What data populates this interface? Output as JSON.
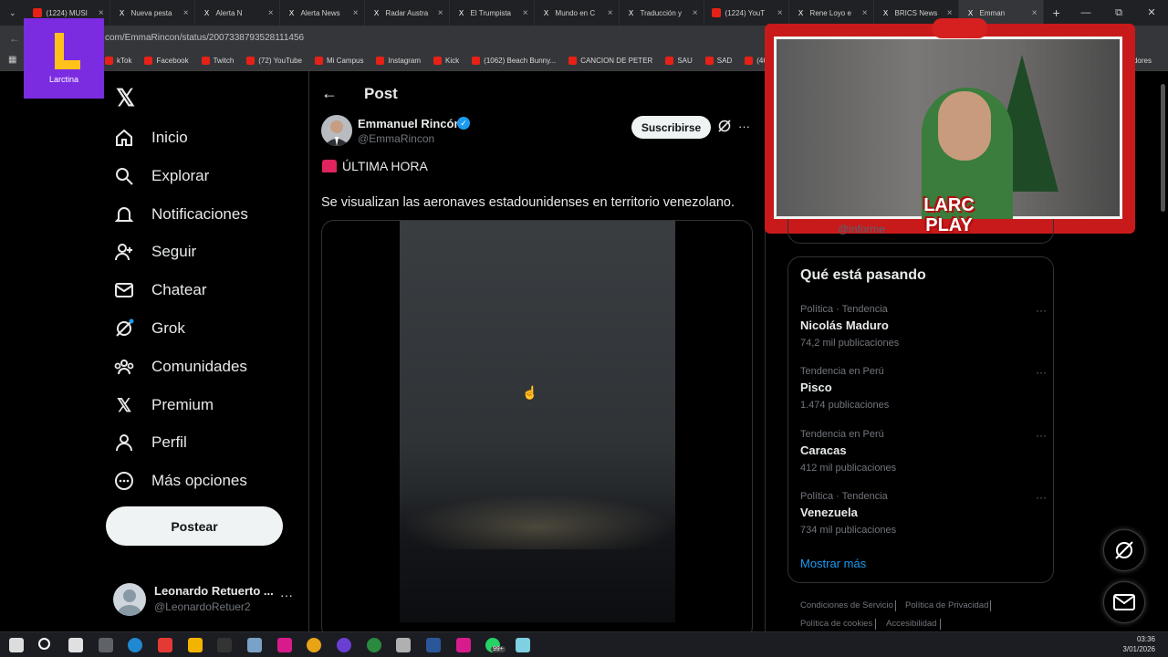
{
  "browser": {
    "tabs": [
      {
        "label": "(1224) MUSI",
        "color": "#e62117"
      },
      {
        "label": "Nueva pesta",
        "color": "#ffffff"
      },
      {
        "label": "Alerta N",
        "color": "#ffffff"
      },
      {
        "label": "Alerta News",
        "color": "#ffffff"
      },
      {
        "label": "Radar Austra",
        "color": "#ffffff"
      },
      {
        "label": "El Trumpista",
        "color": "#ffffff"
      },
      {
        "label": "Mundo en C",
        "color": "#ffffff"
      },
      {
        "label": "Traducción y",
        "color": "#ffffff"
      },
      {
        "label": "(1224) YouT",
        "color": "#e62117"
      },
      {
        "label": "Rene Loyo e",
        "color": "#ffffff"
      },
      {
        "label": "BRICS News",
        "color": "#ffffff"
      },
      {
        "label": "Emman",
        "color": "#ffffff"
      }
    ],
    "url": "com/EmmaRincon/status/2007338793528111456",
    "bookmarks": [
      {
        "label": "kTok"
      },
      {
        "label": "Facebook"
      },
      {
        "label": "Twitch"
      },
      {
        "label": "(72) YouTube"
      },
      {
        "label": "Mi Campus"
      },
      {
        "label": "Instagram"
      },
      {
        "label": "Kick"
      },
      {
        "label": "(1062) Beach Bunny..."
      },
      {
        "label": "CANCION DE PETER"
      },
      {
        "label": "SAU"
      },
      {
        "label": "SAD"
      },
      {
        "label": "(463) James Arth"
      }
    ],
    "bookmarks_right": "cadores"
  },
  "logo_overlay": {
    "text": "Larctina"
  },
  "nav": {
    "items": [
      {
        "label": "Inicio",
        "icon": "home-icon"
      },
      {
        "label": "Explorar",
        "icon": "search-icon"
      },
      {
        "label": "Notificaciones",
        "icon": "bell-icon"
      },
      {
        "label": "Seguir",
        "icon": "follow-icon"
      },
      {
        "label": "Chatear",
        "icon": "mail-icon"
      },
      {
        "label": "Grok",
        "icon": "grok-icon"
      },
      {
        "label": "Comunidades",
        "icon": "communities-icon"
      },
      {
        "label": "Premium",
        "icon": "x-icon"
      },
      {
        "label": "Perfil",
        "icon": "person-icon"
      },
      {
        "label": "Más opciones",
        "icon": "more-icon"
      }
    ],
    "post_button": "Postear",
    "account": {
      "name": "Leonardo Retuerto ...",
      "handle": "@LeonardoRetuer2"
    }
  },
  "post": {
    "header": "Post",
    "author_name": "Emmanuel Rincón",
    "author_handle": "@EmmaRincon",
    "subscribe_label": "Suscribirse",
    "breaking": "ÚLTIMA HORA",
    "text": "Se visualizan las aeronaves estadounidenses en territorio venezolano."
  },
  "overlay": {
    "brand_line1": "LARC",
    "brand_line2": "PLAY"
  },
  "sidebar": {
    "prev_handle": "@informe",
    "trends_title": "Qué está pasando",
    "trends": [
      {
        "context": "Política · Tendencia",
        "name": "Nicolás Maduro",
        "count": "74,2 mil publicaciones"
      },
      {
        "context": "Tendencia en Perú",
        "name": "Pisco",
        "count": "1.474 publicaciones"
      },
      {
        "context": "Tendencia en Perú",
        "name": "Caracas",
        "count": "412 mil publicaciones"
      },
      {
        "context": "Política · Tendencia",
        "name": "Venezuela",
        "count": "734 mil publicaciones"
      }
    ],
    "show_more": "Mostrar más",
    "footer": [
      "Condiciones de Servicio",
      "Política de Privacidad",
      "Política de cookies",
      "Accesibilidad"
    ]
  },
  "taskbar": {
    "time": "03:36",
    "date": "3/01/2026",
    "badge": "99+"
  },
  "colors": {
    "accent": "#1d9bf0",
    "brand_purple": "#7b2be0",
    "overlay_red": "#c81a1a"
  }
}
